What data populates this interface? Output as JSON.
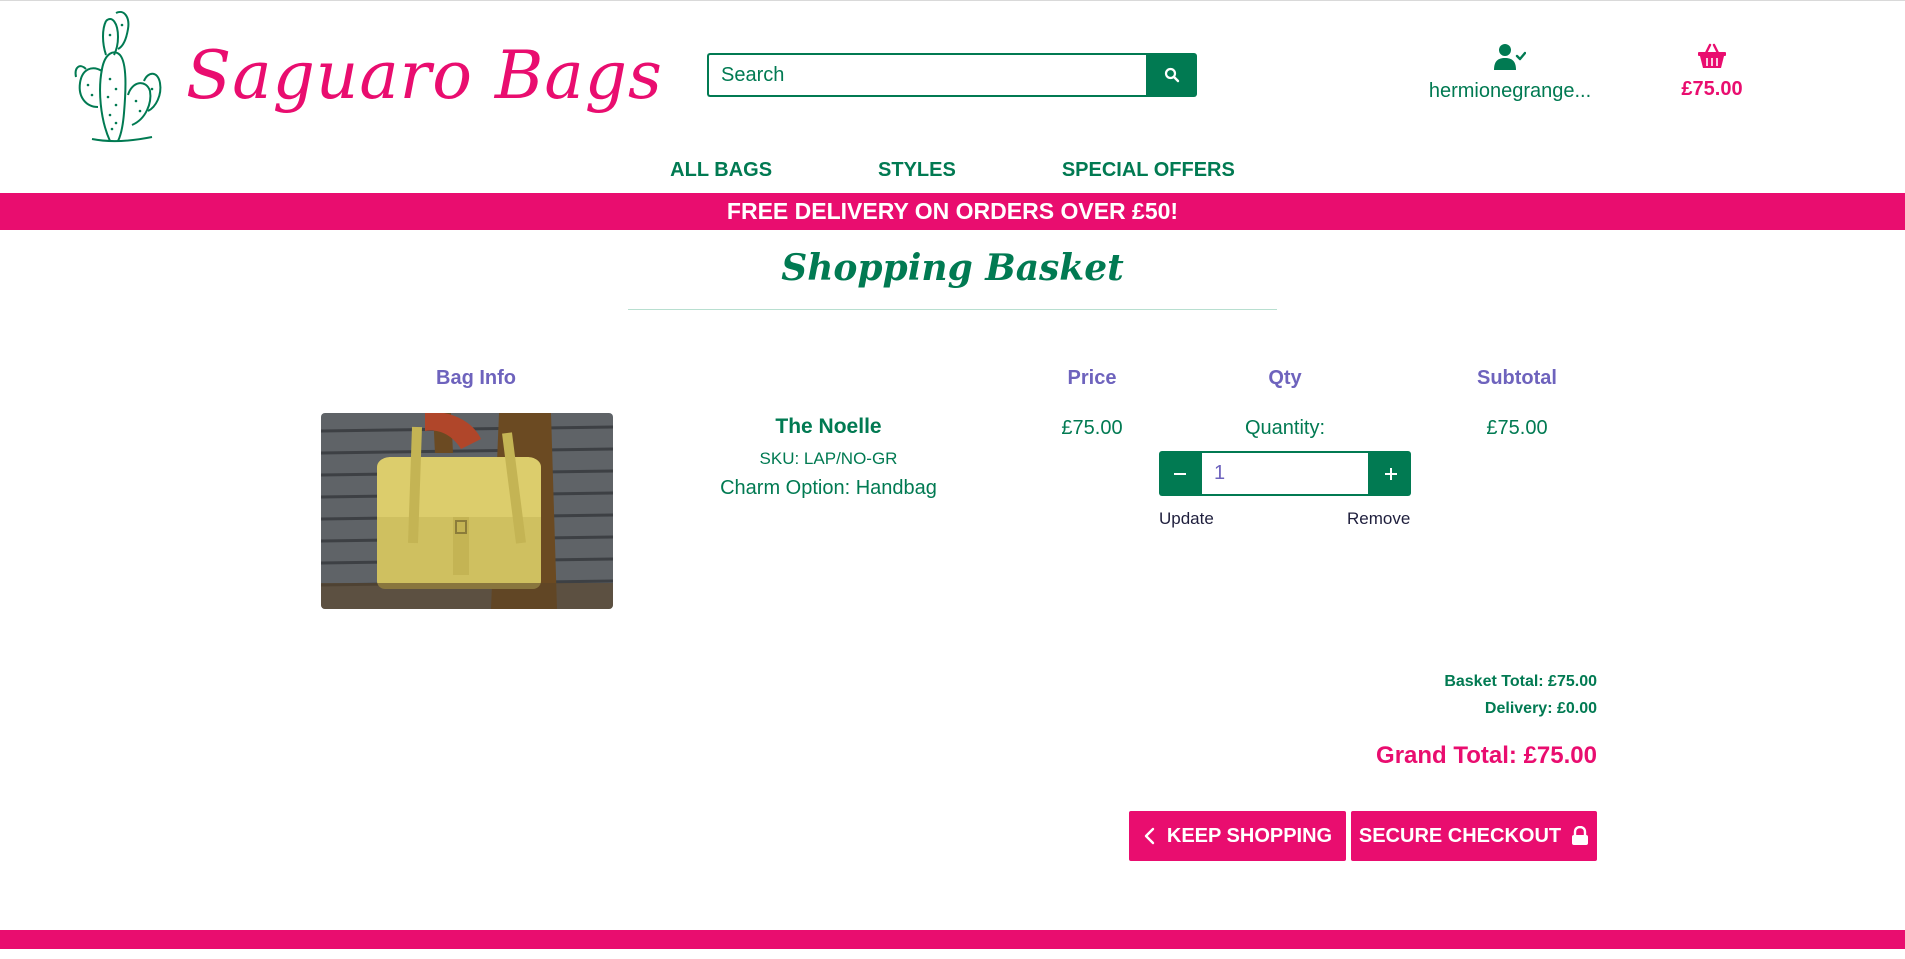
{
  "brand": {
    "name": "Saguaro Bags",
    "primary_color": "#017a52",
    "accent_color": "#e90d6f",
    "header_text_color": "#6e63bd"
  },
  "header": {
    "search_placeholder": "Search",
    "search_icon": "search-icon",
    "account_icon": "user-check-icon",
    "account_name": "hermionegrange...",
    "cart_icon": "shopping-basket-icon",
    "cart_total": "£75.00"
  },
  "nav": {
    "items": [
      {
        "label": "ALL BAGS"
      },
      {
        "label": "STYLES"
      },
      {
        "label": "SPECIAL OFFERS"
      }
    ]
  },
  "banner": {
    "text": "FREE DELIVERY ON ORDERS OVER £50!"
  },
  "page": {
    "title": "Shopping Basket"
  },
  "table": {
    "headers": {
      "bag_info": "Bag Info",
      "price": "Price",
      "qty": "Qty",
      "subtotal": "Subtotal"
    }
  },
  "item": {
    "name": "The Noelle",
    "sku": "SKU: LAP/NO-GR",
    "charm": "Charm Option: Handbag",
    "price": "£75.00",
    "quantity_label": "Quantity:",
    "quantity": "1",
    "update_label": "Update",
    "remove_label": "Remove",
    "subtotal": "£75.00"
  },
  "totals": {
    "basket_total": "Basket Total: £75.00",
    "delivery": "Delivery: £0.00",
    "grand_total": "Grand Total: £75.00"
  },
  "actions": {
    "keep_shopping": "KEEP SHOPPING",
    "secure_checkout": "SECURE CHECKOUT"
  }
}
